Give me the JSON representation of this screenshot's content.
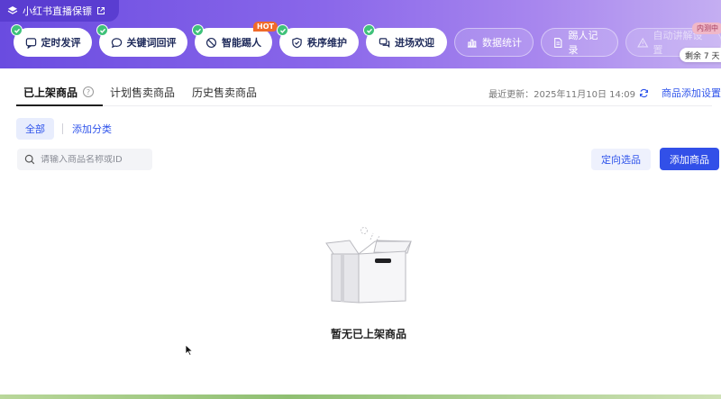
{
  "brand": {
    "title": "小红书直播保镖"
  },
  "tools": [
    {
      "label": "定时发评",
      "icon": "send-icon",
      "enabled_check": true
    },
    {
      "label": "关键词回评",
      "icon": "chat-icon",
      "enabled_check": true
    },
    {
      "label": "智能踢人",
      "icon": "ban-icon",
      "enabled_check": true,
      "badge": "HOT"
    },
    {
      "label": "秩序维护",
      "icon": "shield-icon",
      "enabled_check": true
    },
    {
      "label": "进场欢迎",
      "icon": "welcome-icon",
      "enabled_check": true
    },
    {
      "label": "数据统计",
      "icon": "chart-icon"
    },
    {
      "label": "踢人记录",
      "icon": "doc-icon"
    },
    {
      "label": "自动讲解设置",
      "icon": "warning-icon",
      "badge": "内测中"
    }
  ],
  "trial": {
    "text": "剩余 7 天"
  },
  "tabs": [
    {
      "label": "已上架商品",
      "active": true
    },
    {
      "label": "计划售卖商品"
    },
    {
      "label": "历史售卖商品"
    }
  ],
  "help": {
    "symbol": "?"
  },
  "update": {
    "label": "最近更新：2025年11月10日 14:09"
  },
  "settings_link": "商品添加设置",
  "categories": {
    "all": "全部",
    "add": "添加分类"
  },
  "search": {
    "placeholder": "请输入商品名称或ID"
  },
  "buttons": {
    "select": "定向选品",
    "add": "添加商品"
  },
  "empty": {
    "text": "暂无已上架商品"
  },
  "colors": {
    "brand": "#6a4ce0",
    "primary": "#3250e8",
    "link": "#2f54eb",
    "success": "#3fc27a",
    "hot": "#f06a2a"
  }
}
